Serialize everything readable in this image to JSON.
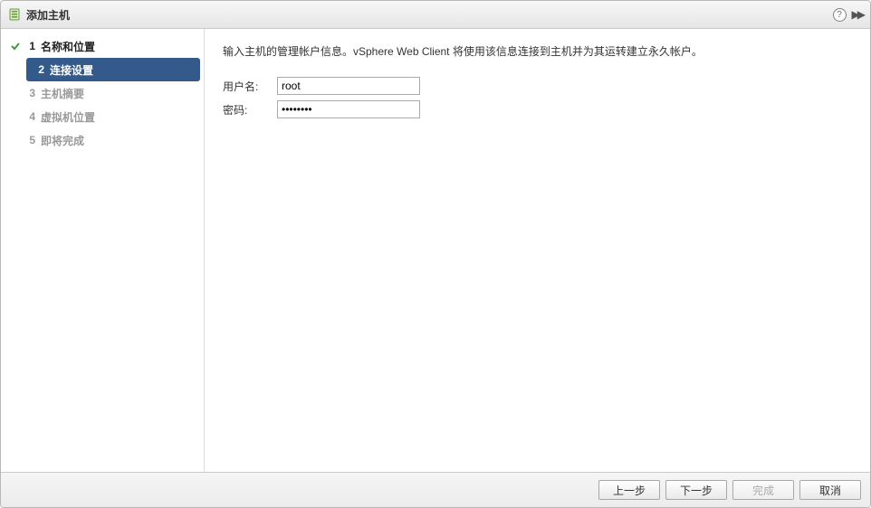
{
  "title": "添加主机",
  "steps": [
    {
      "num": "1",
      "label": "名称和位置",
      "state": "completed"
    },
    {
      "num": "2",
      "label": "连接设置",
      "state": "active"
    },
    {
      "num": "3",
      "label": "主机摘要",
      "state": "pending"
    },
    {
      "num": "4",
      "label": "虚拟机位置",
      "state": "pending"
    },
    {
      "num": "5",
      "label": "即将完成",
      "state": "pending"
    }
  ],
  "instruction": "输入主机的管理帐户信息。vSphere Web Client 将使用该信息连接到主机并为其运转建立永久帐户。",
  "form": {
    "username_label": "用户名:",
    "username_value": "root",
    "password_label": "密码:",
    "password_value": "********"
  },
  "buttons": {
    "back": "上一步",
    "next": "下一步",
    "finish": "完成",
    "cancel": "取消"
  }
}
